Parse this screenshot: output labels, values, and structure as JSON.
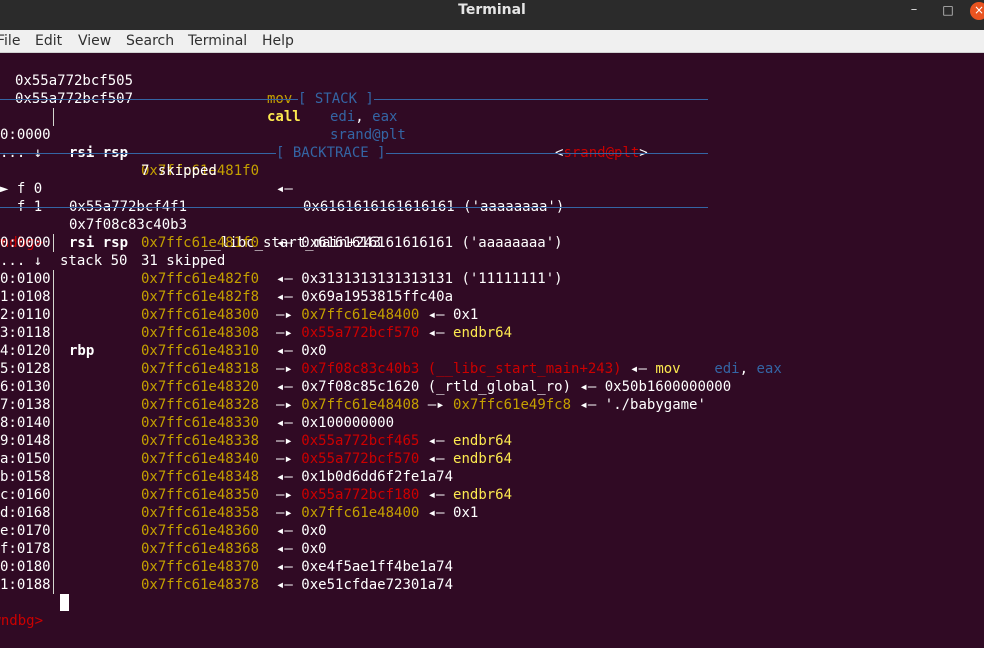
{
  "window": {
    "title": "Terminal",
    "minimize": "–",
    "maximize": "□",
    "close": "×"
  },
  "menu": [
    "File",
    "Edit",
    "View",
    "Search",
    "Terminal",
    "Help"
  ],
  "disasm": [
    {
      "addr": "0x55a772bcf505",
      "op": "mov",
      "args": [
        {
          "t": "edi",
          "c": "b"
        },
        {
          "t": ", ",
          "c": "w"
        },
        {
          "t": "eax",
          "c": "b"
        }
      ]
    },
    {
      "addr": "0x55a772bcf507",
      "op": "call",
      "args": [
        {
          "t": "srand@plt",
          "c": "b"
        }
      ],
      "target_open": "<",
      "target": "srand@plt",
      "target_close": ">"
    }
  ],
  "sections": {
    "stack": "[ STACK ]",
    "backtrace": "[ BACKTRACE ]"
  },
  "stack_top": [
    {
      "idx": "0:0000",
      "regs": "rsi rsp",
      "addr": "0x7ffc61e481f0",
      "arrow": "◂—",
      "val": "0x6161616161616161 ('aaaaaaaa')"
    },
    {
      "idx": "... ↓",
      "regs": "",
      "text": "7 skipped"
    }
  ],
  "backtrace": [
    {
      "mark": "► f 0",
      "addr": "0x55a772bcf4f1",
      "sym": ""
    },
    {
      "mark": "  f 1",
      "addr": "0x7f08c83c40b3",
      "sym": "__libc_start_main+243"
    }
  ],
  "prompt": "pwndbg>",
  "command": "stack 50",
  "stack": [
    {
      "idx": "0:0000",
      "regs": "rsi rsp",
      "addr": "0x7ffc61e481f0",
      "parts": [
        {
          "t": "◂— ",
          "c": "w"
        },
        {
          "t": "0x6161616161616161 ('aaaaaaaa')",
          "c": "w"
        }
      ]
    },
    {
      "idx": "... ↓",
      "regs": "",
      "addr": "",
      "parts": [
        {
          "t": "31 skipped",
          "c": "w"
        }
      ]
    },
    {
      "idx": "0:0100",
      "regs": "",
      "addr": "0x7ffc61e482f0",
      "parts": [
        {
          "t": "◂— ",
          "c": "w"
        },
        {
          "t": "0x3131313131313131 ('11111111')",
          "c": "w"
        }
      ]
    },
    {
      "idx": "1:0108",
      "regs": "",
      "addr": "0x7ffc61e482f8",
      "parts": [
        {
          "t": "◂— ",
          "c": "w"
        },
        {
          "t": "0x69a1953815ffc40a",
          "c": "w"
        }
      ]
    },
    {
      "idx": "2:0110",
      "regs": "",
      "addr": "0x7ffc61e48300",
      "parts": [
        {
          "t": "—▸ ",
          "c": "w"
        },
        {
          "t": "0x7ffc61e48400",
          "c": "y"
        },
        {
          "t": " ◂— ",
          "c": "w"
        },
        {
          "t": "0x1",
          "c": "w"
        }
      ]
    },
    {
      "idx": "3:0118",
      "regs": "",
      "addr": "0x7ffc61e48308",
      "parts": [
        {
          "t": "—▸ ",
          "c": "w"
        },
        {
          "t": "0x55a772bcf570",
          "c": "r"
        },
        {
          "t": " ◂— ",
          "c": "w"
        },
        {
          "t": "endbr64",
          "c": "ly"
        }
      ]
    },
    {
      "idx": "4:0120",
      "regs": "rbp",
      "addr": "0x7ffc61e48310",
      "parts": [
        {
          "t": "◂— ",
          "c": "w"
        },
        {
          "t": "0x0",
          "c": "w"
        }
      ]
    },
    {
      "idx": "5:0128",
      "regs": "",
      "addr": "0x7ffc61e48318",
      "parts": [
        {
          "t": "—▸ ",
          "c": "w"
        },
        {
          "t": "0x7f08c83c40b3 (__libc_start_main+243)",
          "c": "r"
        },
        {
          "t": " ◂— ",
          "c": "w"
        },
        {
          "t": "mov    ",
          "c": "ly"
        },
        {
          "t": "edi",
          "c": "b"
        },
        {
          "t": ", ",
          "c": "w"
        },
        {
          "t": "eax",
          "c": "b"
        }
      ]
    },
    {
      "idx": "6:0130",
      "regs": "",
      "addr": "0x7ffc61e48320",
      "parts": [
        {
          "t": "◂— ",
          "c": "w"
        },
        {
          "t": "0x7f08c85c1620 (_rtld_global_ro) ◂— 0x50b1600000000",
          "c": "w"
        }
      ]
    },
    {
      "idx": "7:0138",
      "regs": "",
      "addr": "0x7ffc61e48328",
      "parts": [
        {
          "t": "—▸ ",
          "c": "w"
        },
        {
          "t": "0x7ffc61e48408",
          "c": "y"
        },
        {
          "t": " —▸ ",
          "c": "w"
        },
        {
          "t": "0x7ffc61e49fc8",
          "c": "y"
        },
        {
          "t": " ◂— './babygame'",
          "c": "w"
        }
      ]
    },
    {
      "idx": "8:0140",
      "regs": "",
      "addr": "0x7ffc61e48330",
      "parts": [
        {
          "t": "◂— ",
          "c": "w"
        },
        {
          "t": "0x100000000",
          "c": "w"
        }
      ]
    },
    {
      "idx": "9:0148",
      "regs": "",
      "addr": "0x7ffc61e48338",
      "parts": [
        {
          "t": "—▸ ",
          "c": "w"
        },
        {
          "t": "0x55a772bcf465",
          "c": "r"
        },
        {
          "t": " ◂— ",
          "c": "w"
        },
        {
          "t": "endbr64",
          "c": "ly"
        }
      ]
    },
    {
      "idx": "a:0150",
      "regs": "",
      "addr": "0x7ffc61e48340",
      "parts": [
        {
          "t": "—▸ ",
          "c": "w"
        },
        {
          "t": "0x55a772bcf570",
          "c": "r"
        },
        {
          "t": " ◂— ",
          "c": "w"
        },
        {
          "t": "endbr64",
          "c": "ly"
        }
      ]
    },
    {
      "idx": "b:0158",
      "regs": "",
      "addr": "0x7ffc61e48348",
      "parts": [
        {
          "t": "◂— ",
          "c": "w"
        },
        {
          "t": "0x1b0d6dd6f2fe1a74",
          "c": "w"
        }
      ]
    },
    {
      "idx": "c:0160",
      "regs": "",
      "addr": "0x7ffc61e48350",
      "parts": [
        {
          "t": "—▸ ",
          "c": "w"
        },
        {
          "t": "0x55a772bcf180",
          "c": "r"
        },
        {
          "t": " ◂— ",
          "c": "w"
        },
        {
          "t": "endbr64",
          "c": "ly"
        }
      ]
    },
    {
      "idx": "d:0168",
      "regs": "",
      "addr": "0x7ffc61e48358",
      "parts": [
        {
          "t": "—▸ ",
          "c": "w"
        },
        {
          "t": "0x7ffc61e48400",
          "c": "y"
        },
        {
          "t": " ◂— ",
          "c": "w"
        },
        {
          "t": "0x1",
          "c": "w"
        }
      ]
    },
    {
      "idx": "e:0170",
      "regs": "",
      "addr": "0x7ffc61e48360",
      "parts": [
        {
          "t": "◂— ",
          "c": "w"
        },
        {
          "t": "0x0",
          "c": "w"
        }
      ]
    },
    {
      "idx": "f:0178",
      "regs": "",
      "addr": "0x7ffc61e48368",
      "parts": [
        {
          "t": "◂— ",
          "c": "w"
        },
        {
          "t": "0x0",
          "c": "w"
        }
      ]
    },
    {
      "idx": "0:0180",
      "regs": "",
      "addr": "0x7ffc61e48370",
      "parts": [
        {
          "t": "◂— ",
          "c": "w"
        },
        {
          "t": "0xe4f5ae1ff4be1a74",
          "c": "w"
        }
      ]
    },
    {
      "idx": "1:0188",
      "regs": "",
      "addr": "0x7ffc61e48378",
      "parts": [
        {
          "t": "◂— ",
          "c": "w"
        },
        {
          "t": "0xe51cfdae72301a74",
          "c": "w"
        }
      ]
    }
  ],
  "colors": {
    "background": "#300a24",
    "addr": "#c4a000",
    "heap_code": "#cc0000",
    "reg": "#3465a4",
    "instr": "#fce94f",
    "prompt": "#cc0000",
    "close_btn": "#e95420"
  }
}
